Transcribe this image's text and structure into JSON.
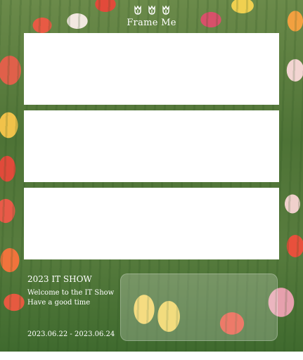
{
  "brand": {
    "icons": [
      "tulip-icon",
      "tulip-icon",
      "tulip-icon"
    ],
    "title": "Frame Me"
  },
  "event": {
    "title": "2023 IT SHOW",
    "line1": "Welcome to the IT Show",
    "line2": "Have a good time",
    "dates": "2023.06.22 - 2023.06.24"
  },
  "colors": {
    "panel": "#ffffff",
    "text": "#ffffff"
  }
}
